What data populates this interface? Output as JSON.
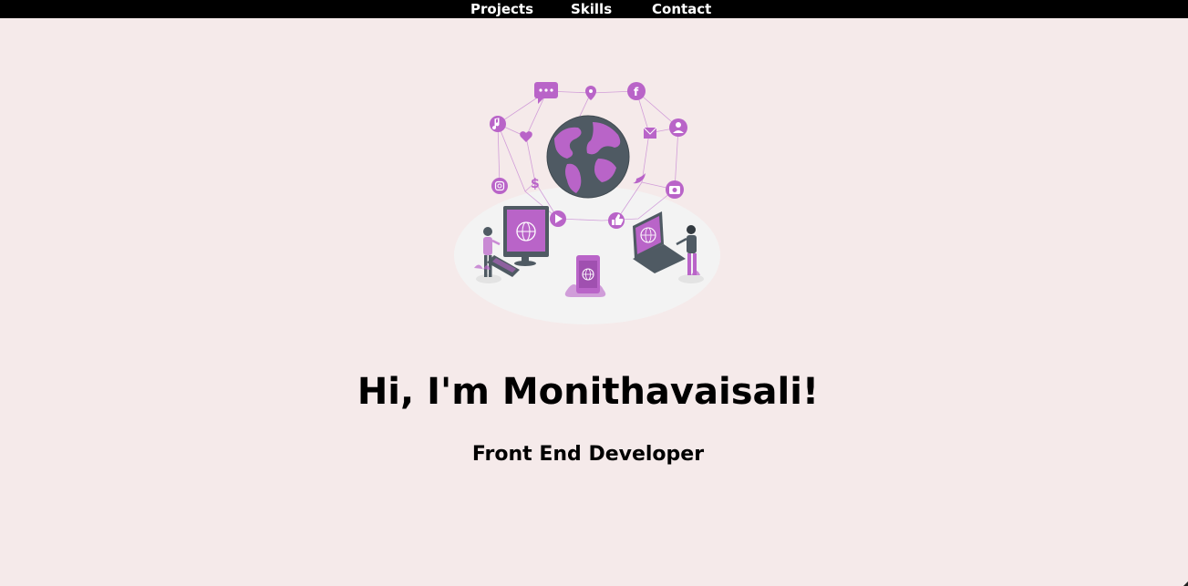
{
  "nav": {
    "items": [
      {
        "label": "Projects"
      },
      {
        "label": "Skills"
      },
      {
        "label": "Contact"
      }
    ]
  },
  "hero": {
    "title": "Hi, I'm Monithavaisali!",
    "subtitle": "Front End Developer",
    "illustration_icons": [
      "chat-icon",
      "location-pin-icon",
      "facebook-icon",
      "music-note-icon",
      "heart-icon",
      "mail-icon",
      "user-icon",
      "dollar-icon",
      "instagram-icon",
      "twitter-icon",
      "camera-icon",
      "play-icon",
      "like-icon",
      "globe-icon",
      "desktop-icon",
      "laptop-icon",
      "smartphone-icon"
    ]
  },
  "colors": {
    "background": "#f5eaea",
    "navbar": "#000000",
    "accent_purple": "#b964c8",
    "globe_dark": "#4f5a63"
  }
}
